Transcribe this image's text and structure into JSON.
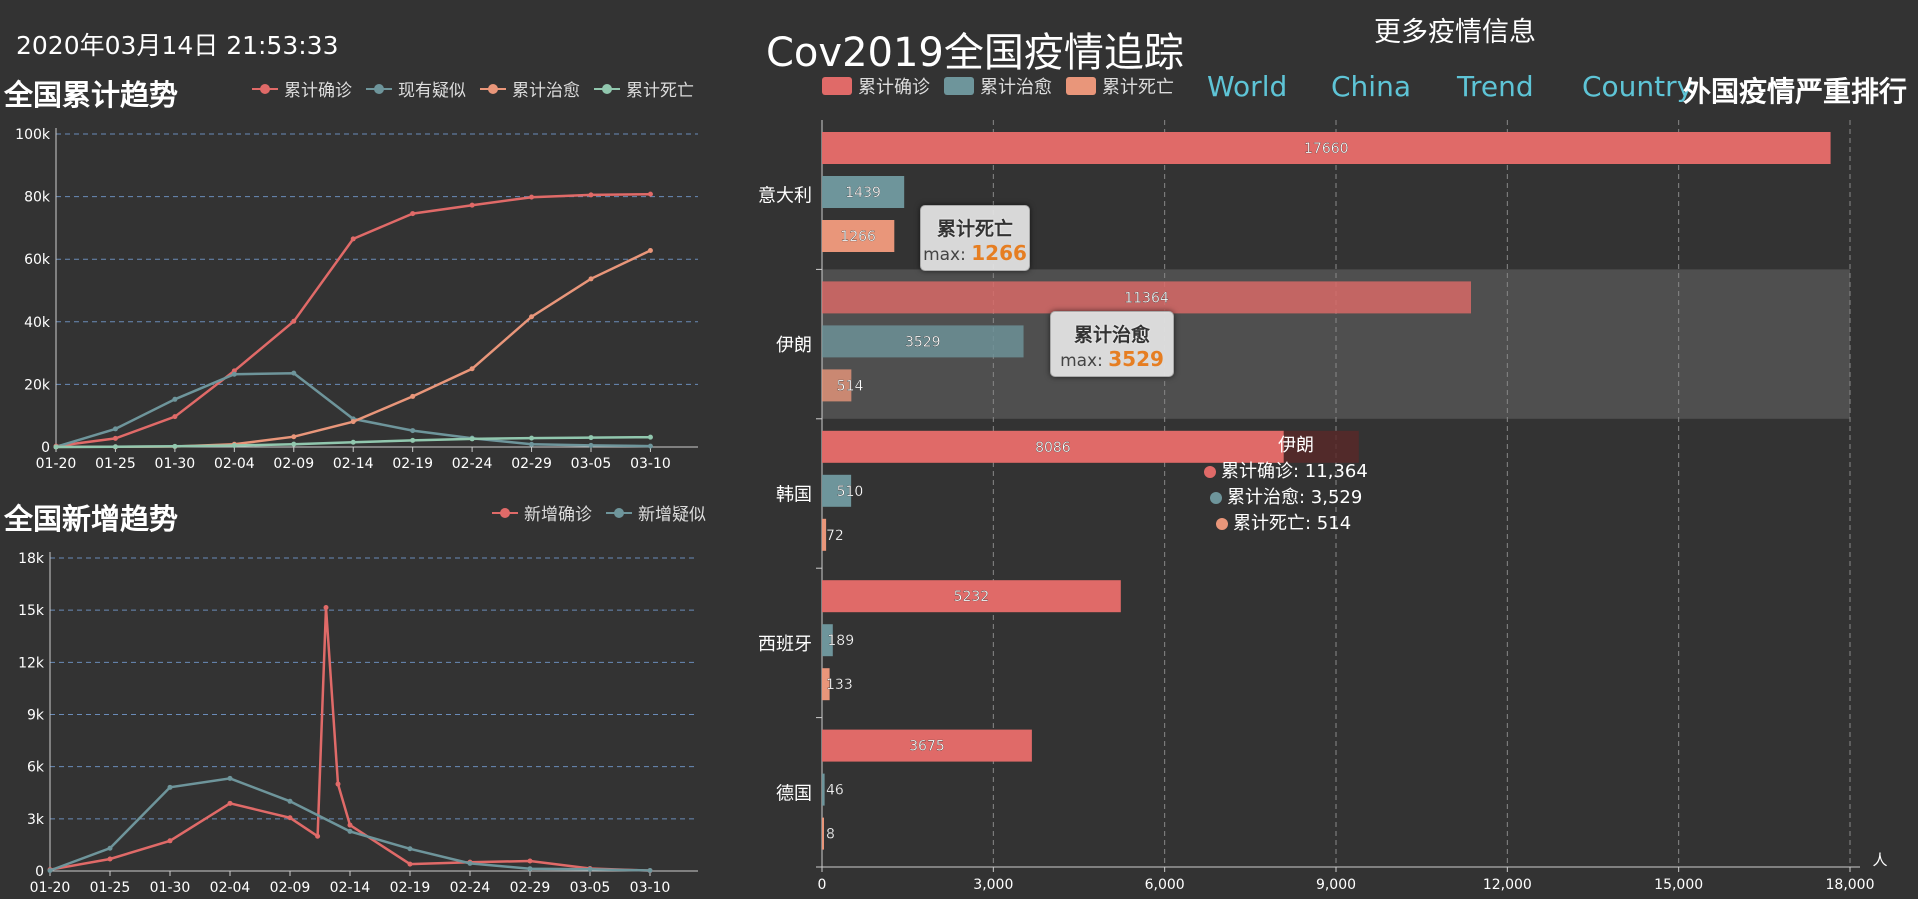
{
  "header": {
    "datetime": "2020年03月14日 21:53:33",
    "title": "Cov2019全国疫情追踪",
    "more_info": "更多疫情信息",
    "nav": [
      "World",
      "China",
      "Trend",
      "Country"
    ],
    "rank_title": "外国疫情严重排行"
  },
  "colors": {
    "confirmed": "#e06a68",
    "suspect": "#6e959b",
    "cured": "#e9967a",
    "dead": "#91c7ae",
    "bg": "#333333"
  },
  "cumulative_panel": {
    "title": "全国累计趋势",
    "legend": [
      "累计确诊",
      "现有疑似",
      "累计治愈",
      "累计死亡"
    ]
  },
  "new_panel": {
    "title": "全国新增趋势",
    "legend": [
      "新增确诊",
      "新增疑似"
    ]
  },
  "ranking_panel": {
    "legend": [
      "累计确诊",
      "累计治愈",
      "累计死亡"
    ],
    "unit": "人",
    "tooltips": [
      {
        "title": "累计死亡",
        "label": "max:",
        "value": "1266"
      },
      {
        "title": "累计治愈",
        "label": "max:",
        "value": "3529"
      }
    ],
    "hover": {
      "country": "伊朗",
      "lines": [
        "累计确诊: 11,364",
        "累计治愈: 3,529",
        "累计死亡: 514"
      ]
    }
  },
  "chart_data": [
    {
      "type": "line",
      "title": "全国累计趋势",
      "x": [
        "01-20",
        "01-25",
        "01-30",
        "02-04",
        "02-09",
        "02-14",
        "02-19",
        "02-24",
        "02-29",
        "03-05",
        "03-10"
      ],
      "x_range": [
        "01-20",
        "03-14"
      ],
      "ylim": [
        0,
        100000
      ],
      "yticks": [
        "0",
        "20k",
        "40k",
        "60k",
        "80k",
        "100k"
      ],
      "series": [
        {
          "name": "累计确诊",
          "values": [
            291,
            2744,
            9692,
            24324,
            40171,
            66492,
            74576,
            77262,
            79824,
            80552,
            80778
          ]
        },
        {
          "name": "现有疑似",
          "values": [
            54,
            5794,
            15238,
            23260,
            23589,
            8969,
            5248,
            2824,
            851,
            522,
            285
          ]
        },
        {
          "name": "累计治愈",
          "values": [
            25,
            51,
            171,
            892,
            3281,
            8096,
            16155,
            24990,
            41625,
            53726,
            62793
          ]
        },
        {
          "name": "累计死亡",
          "values": [
            6,
            80,
            213,
            490,
            908,
            1524,
            2118,
            2595,
            2835,
            3015,
            3139
          ]
        }
      ],
      "grid": true
    },
    {
      "type": "line",
      "title": "全国新增趋势",
      "x": [
        "01-20",
        "01-25",
        "01-30",
        "02-04",
        "02-09",
        "02-14",
        "02-19",
        "02-24",
        "02-29",
        "03-05",
        "03-10"
      ],
      "x_range": [
        "01-20",
        "03-14"
      ],
      "ylim": [
        0,
        18000
      ],
      "yticks": [
        "0",
        "3k",
        "6k",
        "9k",
        "12k",
        "15k",
        "18k"
      ],
      "series": [
        {
          "name": "新增确诊",
          "values": [
            77,
            688,
            1737,
            3892,
            3062,
            2641,
            394,
            508,
            573,
            143,
            24
          ]
        },
        {
          "name": "新增疑似",
          "values": [
            27,
            1309,
            4812,
            5328,
            4008,
            2277,
            1277,
            439,
            132,
            102,
            31
          ]
        }
      ],
      "peak": {
        "x": "02-12",
        "value": 15152
      },
      "grid": true
    },
    {
      "type": "bar",
      "orientation": "horizontal",
      "categories": [
        "意大利",
        "伊朗",
        "韩国",
        "西班牙",
        "德国"
      ],
      "series": [
        {
          "name": "累计确诊",
          "values": [
            17660,
            11364,
            8086,
            5232,
            3675
          ]
        },
        {
          "name": "累计治愈",
          "values": [
            1439,
            3529,
            510,
            189,
            46
          ]
        },
        {
          "name": "累计死亡",
          "values": [
            1266,
            514,
            72,
            133,
            8
          ]
        }
      ],
      "xlim": [
        0,
        18000
      ],
      "xticks": [
        "0",
        "3,000",
        "6,000",
        "9,000",
        "12,000",
        "15,000",
        "18,000"
      ],
      "xlabel": "人"
    }
  ]
}
